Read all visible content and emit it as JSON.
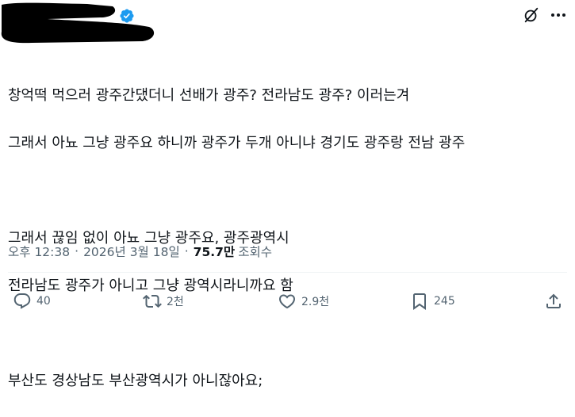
{
  "author": {
    "verified_badge_color": "#1d9bf0"
  },
  "header_icons": {
    "grok": "grok-icon",
    "more": "more-options-icon"
  },
  "tweet": {
    "lines": [
      "창억떡 먹으러 광주간댔더니 선배가 광주? 전라남도 광주? 이러는겨",
      "그래서 아뇨 그냥 광주요 하니까 광주가 두개 아니냐 경기도 광주랑 전남 광주",
      "",
      "그래서 끊임 없이 아뇨 그냥 광주요, 광주광역시",
      "전라남도 광주가 아니고 그냥 광역시라니까요 함",
      "",
      "부산도 경상남도 부산광역시가 아니잖아요;"
    ]
  },
  "meta": {
    "time": "오후 12:38",
    "separator": "·",
    "date": "2026년 3월 18일",
    "views_count": "75.7만",
    "views_label": "조회수"
  },
  "actions": {
    "reply_count": "40",
    "retweet_count": "2천",
    "like_count": "2.9천",
    "bookmark_count": "245"
  },
  "colors": {
    "text": "#0f1419",
    "secondary": "#536471",
    "accent": "#1d9bf0"
  }
}
